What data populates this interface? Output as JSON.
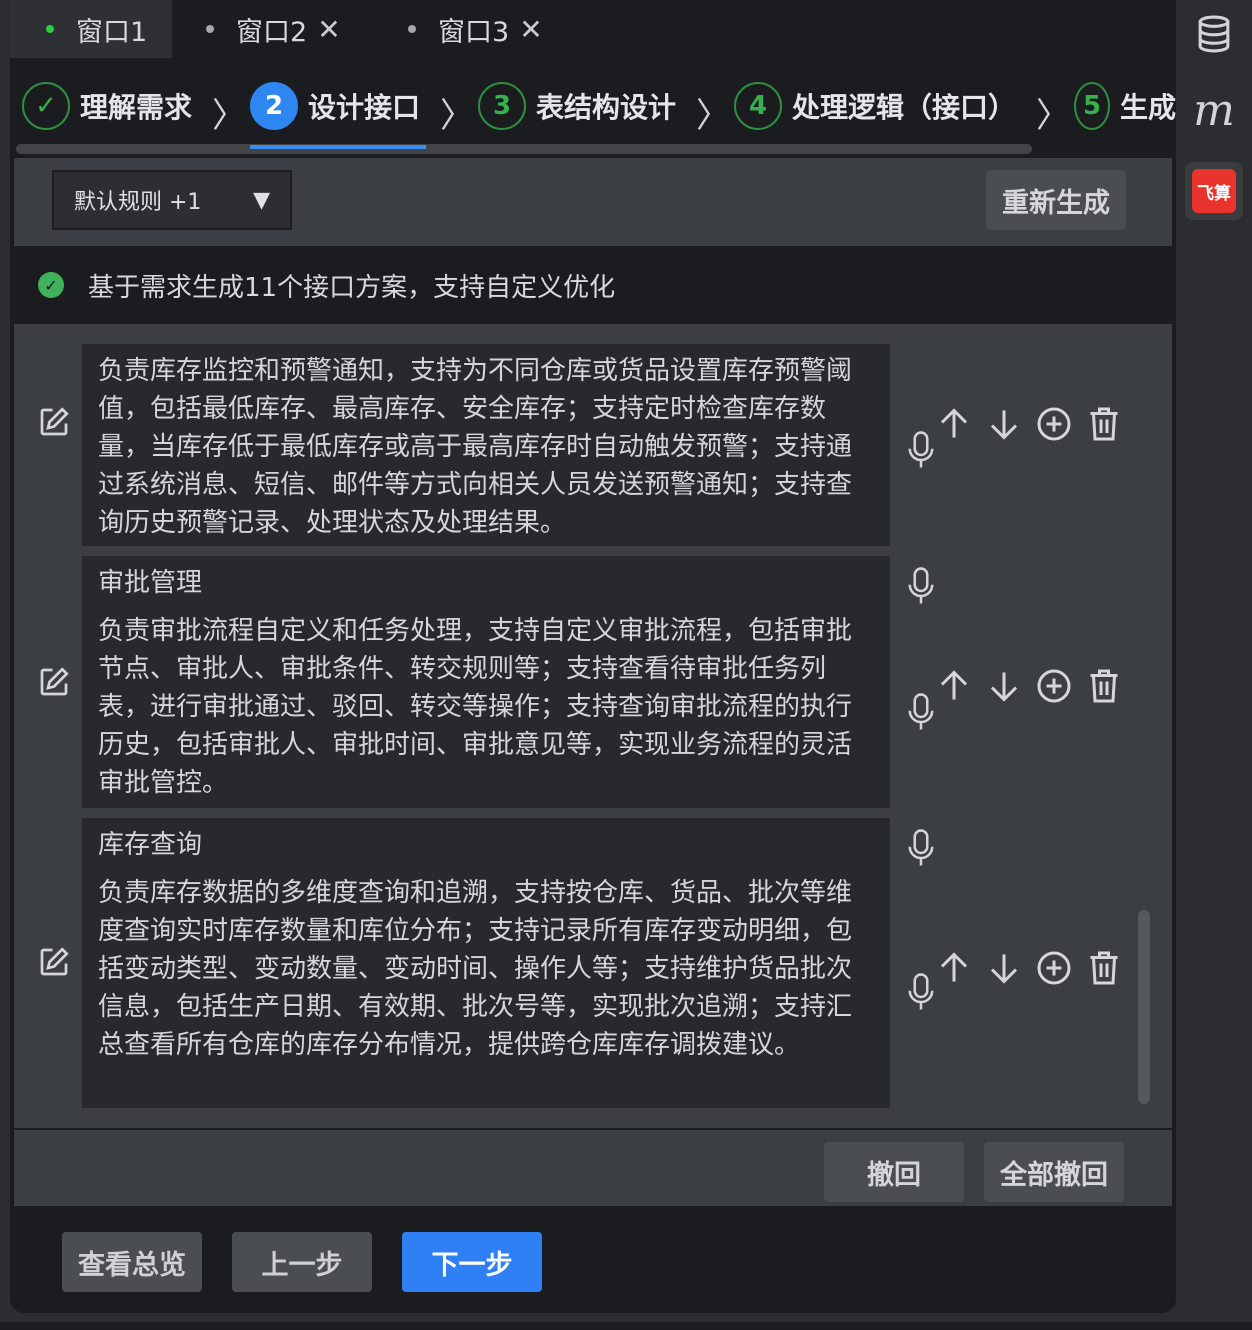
{
  "tabs": [
    {
      "label": "窗口1",
      "active": true,
      "closable": false
    },
    {
      "label": "窗口2",
      "active": false,
      "closable": true
    },
    {
      "label": "窗口3",
      "active": false,
      "closable": true
    }
  ],
  "tab_close_glyph": "✕",
  "steps": [
    {
      "num": "✓",
      "label": "理解需求",
      "state": "done"
    },
    {
      "num": "2",
      "label": "设计接口",
      "state": "active"
    },
    {
      "num": "3",
      "label": "表结构设计",
      "state": "todo"
    },
    {
      "num": "4",
      "label": "处理逻辑（接口）",
      "state": "todo"
    },
    {
      "num": "5",
      "label": "生成",
      "state": "todo"
    }
  ],
  "toolbar": {
    "rule_select": "默认规则 +1",
    "select_arrow": "▼",
    "regenerate": "重新生成"
  },
  "status": {
    "icon": "check-circle-icon",
    "text": "基于需求生成11个接口方案，支持自定义优化"
  },
  "cards": [
    {
      "title": "",
      "text": "负责库存监控和预警通知，支持为不同仓库或货品设置库存预警阈值，包括最低库存、最高库存、安全库存；支持定时检查库存数量，当库存低于最低库存或高于最高库存时自动触发预警；支持通过系统消息、短信、邮件等方式向相关人员发送预警通知；支持查询历史预警记录、处理状态及处理结果。"
    },
    {
      "title": "审批管理",
      "text": "负责审批流程自定义和任务处理，支持自定义审批流程，包括审批节点、审批人、审批条件、转交规则等；支持查看待审批任务列表，进行审批通过、驳回、转交等操作；支持查询审批流程的执行历史，包括审批人、审批时间、审批意见等，实现业务流程的灵活审批管控。"
    },
    {
      "title": "库存查询",
      "text": "负责库存数据的多维度查询和追溯，支持按仓库、货品、批次等维度查询实时库存数量和库位分布；支持记录所有库存变动明细，包括变动类型、变动数量、变动时间、操作人等；支持维护货品批次信息，包括生产日期、有效期、批次号等，实现批次追溯；支持汇总查看所有仓库的库存分布情况，提供跨仓库库存调拨建议。"
    }
  ],
  "undo": {
    "undo": "撤回",
    "undo_all": "全部撤回"
  },
  "footer": {
    "overview": "查看总览",
    "prev": "上一步",
    "next": "下一步"
  },
  "sidebar": {
    "m_label": "m",
    "feishu_label": "飞算"
  },
  "colors": {
    "accent": "#2f7ff5",
    "success": "#3fb15a",
    "step_done": "#35b04c",
    "brand_red": "#e8342d"
  }
}
